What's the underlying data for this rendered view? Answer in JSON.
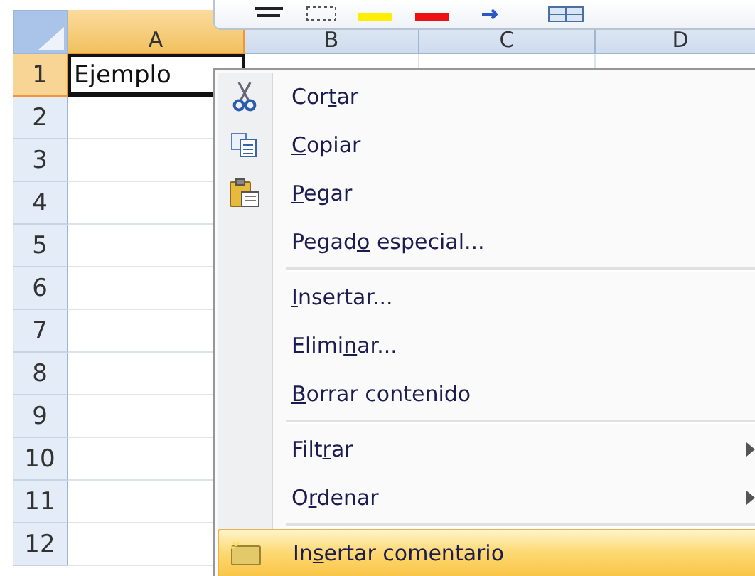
{
  "sheet": {
    "columns": [
      {
        "label": "A",
        "selected": true
      },
      {
        "label": "B",
        "selected": false
      },
      {
        "label": "C",
        "selected": false
      },
      {
        "label": "D",
        "selected": false
      }
    ],
    "rows": [
      {
        "label": "1",
        "selected": true,
        "cells": [
          "Ejemplo"
        ]
      },
      {
        "label": "2",
        "selected": false,
        "cells": []
      },
      {
        "label": "3",
        "selected": false,
        "cells": []
      },
      {
        "label": "4",
        "selected": false,
        "cells": []
      },
      {
        "label": "5",
        "selected": false,
        "cells": []
      },
      {
        "label": "6",
        "selected": false,
        "cells": []
      },
      {
        "label": "7",
        "selected": false,
        "cells": []
      },
      {
        "label": "8",
        "selected": false,
        "cells": []
      },
      {
        "label": "9",
        "selected": false,
        "cells": []
      },
      {
        "label": "10",
        "selected": false,
        "cells": []
      },
      {
        "label": "11",
        "selected": false,
        "cells": []
      },
      {
        "label": "12",
        "selected": false,
        "cells": []
      }
    ]
  },
  "context_menu": {
    "groups": [
      [
        {
          "kind": "cut",
          "label": {
            "before": "Cor",
            "key": "t",
            "after": "ar"
          },
          "submenu": false,
          "selected": false
        },
        {
          "kind": "copy",
          "label": {
            "key": "C",
            "after": "opiar"
          },
          "submenu": false,
          "selected": false
        },
        {
          "kind": "paste",
          "label": {
            "key": "P",
            "after": "egar"
          },
          "submenu": false,
          "selected": false
        },
        {
          "kind": "plain",
          "label": {
            "before": "Pegad",
            "key": "o",
            "after": " especial..."
          },
          "submenu": false,
          "selected": false
        }
      ],
      [
        {
          "kind": "plain",
          "label": {
            "key": "I",
            "after": "nsertar..."
          },
          "submenu": false,
          "selected": false
        },
        {
          "kind": "plain",
          "label": {
            "before": "Elimi",
            "key": "n",
            "after": "ar..."
          },
          "submenu": false,
          "selected": false
        },
        {
          "kind": "plain",
          "label": {
            "key": "B",
            "after": "orrar contenido"
          },
          "submenu": false,
          "selected": false
        }
      ],
      [
        {
          "kind": "plain",
          "label": {
            "before": "Filt",
            "key": "r",
            "after": "ar"
          },
          "submenu": true,
          "selected": false
        },
        {
          "kind": "plain",
          "label": {
            "before": "O",
            "key": "r",
            "after": "denar"
          },
          "submenu": true,
          "selected": false
        }
      ],
      [
        {
          "kind": "comment",
          "label": {
            "before": "In",
            "key": "s",
            "after": "ertar comentario"
          },
          "submenu": false,
          "selected": true
        }
      ]
    ]
  }
}
